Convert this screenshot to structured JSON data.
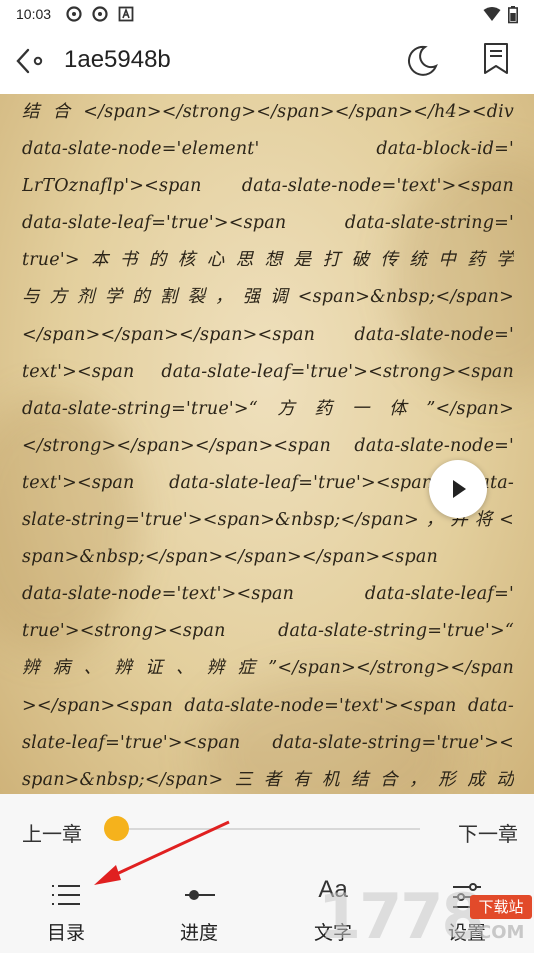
{
  "status_bar": {
    "time": "10:03",
    "icons": [
      "app-icon-1",
      "app-icon-2",
      "a-icon",
      "wifi-icon",
      "battery-icon"
    ]
  },
  "header": {
    "title": "1ae5948b",
    "back_icon": "back-arrow-icon",
    "night_icon": "moon-icon",
    "bookmark_icon": "bookmark-icon"
  },
  "page": {
    "lines": [
      "结 合 </span></strong></span></span></h4><div",
      "data-slate-node='element'       data-block-id='",
      "LrTOznaflp'><span   data-slate-node='text'><span",
      "data-slate-leaf='true'><span   data-slate-string='",
      "true'>本书的核心思想是打破传统中药学",
      "与方剂学的割裂，强调<span>&nbsp;</span>",
      "</span></span></span><span     data-slate-node='",
      "text'><span  data-slate-leaf='true'><strong><span",
      "data-slate-string='true'>“方药一体”</span>",
      "</strong></span></span><span  data-slate-node='",
      "text'><span  data-slate-leaf='true'><span data-",
      "slate-string='true'><span>&nbsp;</span>，并将<",
      "span>&nbsp;</span></span></span><span",
      "data-slate-node='text'><span  data-slate-leaf='",
      "true'><strong><span  data-slate-string='true'>“",
      "辨病、辨证、辨症”</span></strong></span",
      "></span><span data-slate-node='text'><span data-",
      "slate-leaf='true'><span data-slate-string='true'><",
      "span>&nbsp;</span>三者有机结合，形成动"
    ]
  },
  "controls": {
    "prev_chapter": "上一章",
    "next_chapter": "下一章",
    "progress": 0.0,
    "tabs": [
      {
        "label": "目录",
        "icon": "list-icon"
      },
      {
        "label": "进度",
        "icon": "progress-icon"
      },
      {
        "label": "文字",
        "icon": "font-icon",
        "icon_text": "Aa"
      },
      {
        "label": "设置",
        "icon": "settings-icon"
      }
    ]
  },
  "watermark": {
    "text": "1778",
    "badge": "下载站",
    "suffix": "COM"
  },
  "colors": {
    "accent": "#f5b21c",
    "annotation_arrow": "#e02020"
  }
}
